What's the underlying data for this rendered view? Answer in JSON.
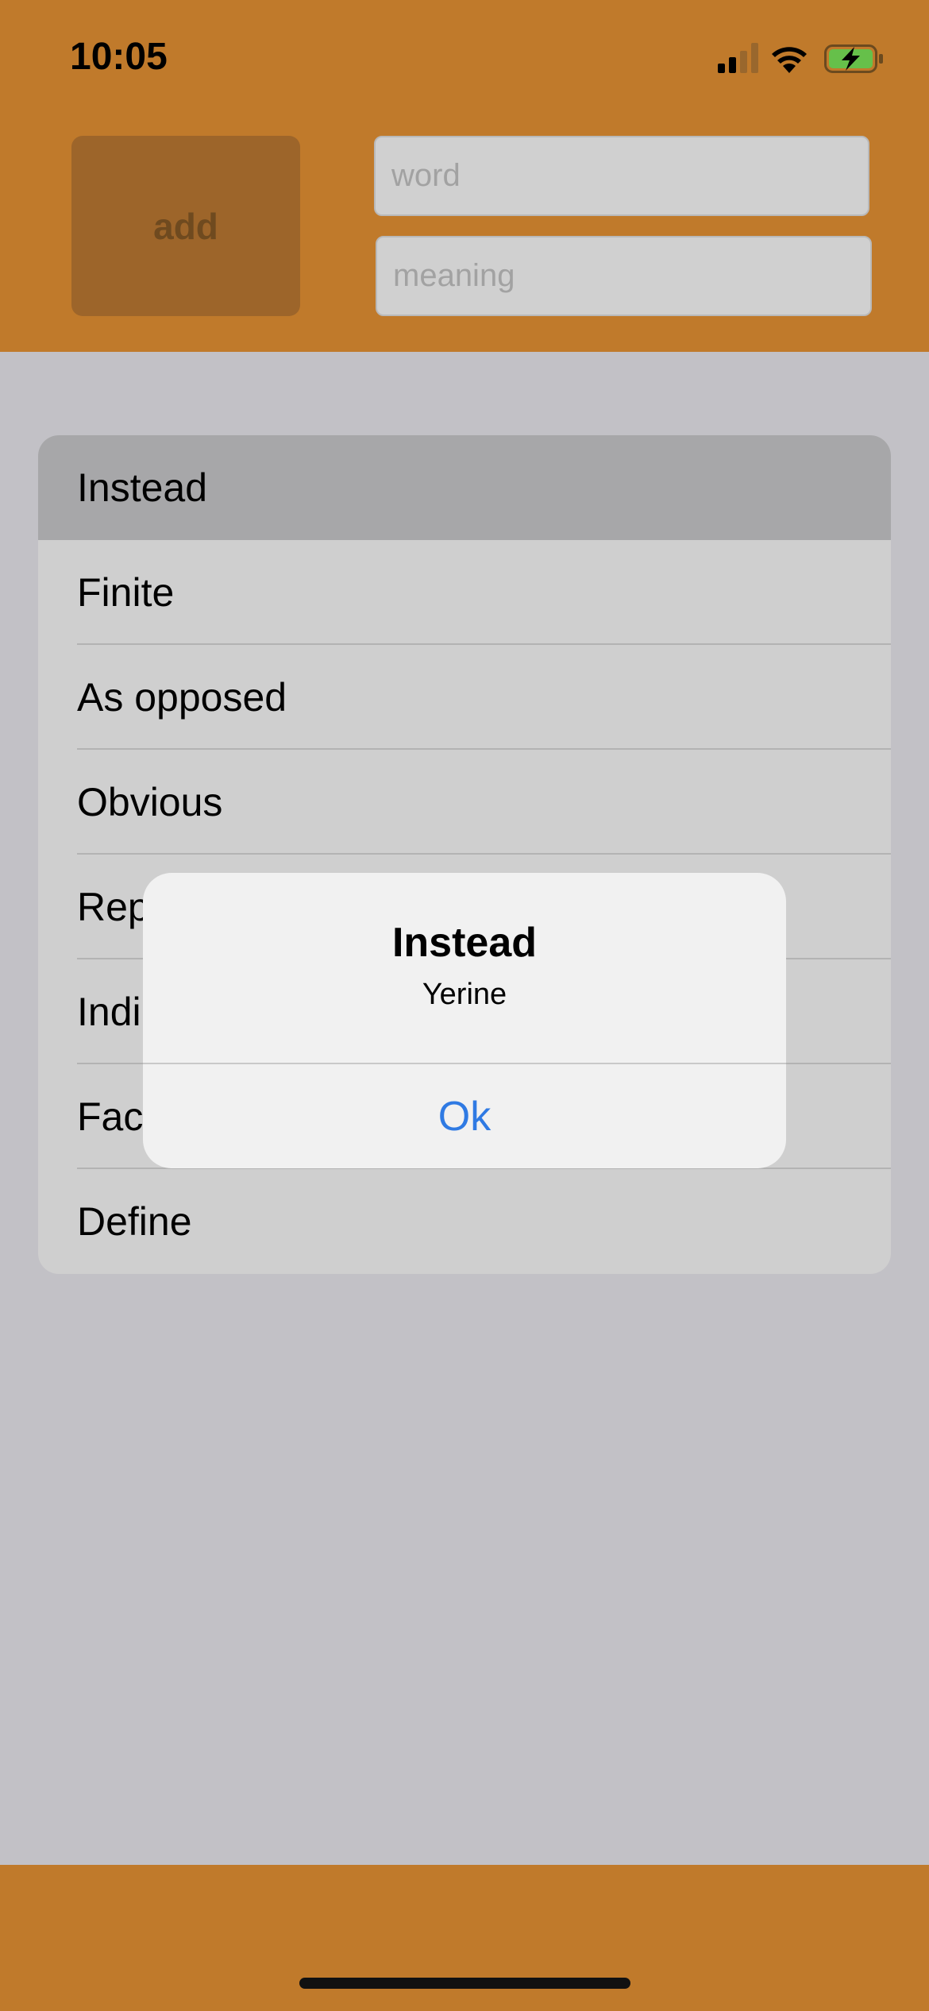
{
  "status_bar": {
    "time": "10:05",
    "icons": [
      "cellular-signal-icon",
      "wifi-icon",
      "battery-charging-icon"
    ]
  },
  "form": {
    "add_label": "add",
    "word_placeholder": "word",
    "meaning_placeholder": "meaning"
  },
  "list": {
    "items": [
      {
        "label": "Instead",
        "selected": true
      },
      {
        "label": "Finite"
      },
      {
        "label": "As opposed"
      },
      {
        "label": "Obvious"
      },
      {
        "label": "Rep"
      },
      {
        "label": "Indi"
      },
      {
        "label": "Fac"
      },
      {
        "label": "Define"
      }
    ]
  },
  "alert": {
    "title": "Instead",
    "message": "Yerine",
    "ok_label": "Ok"
  },
  "colors": {
    "header": "#c07a2b",
    "background": "#c2c1c6",
    "accent": "#2f7ae3"
  }
}
